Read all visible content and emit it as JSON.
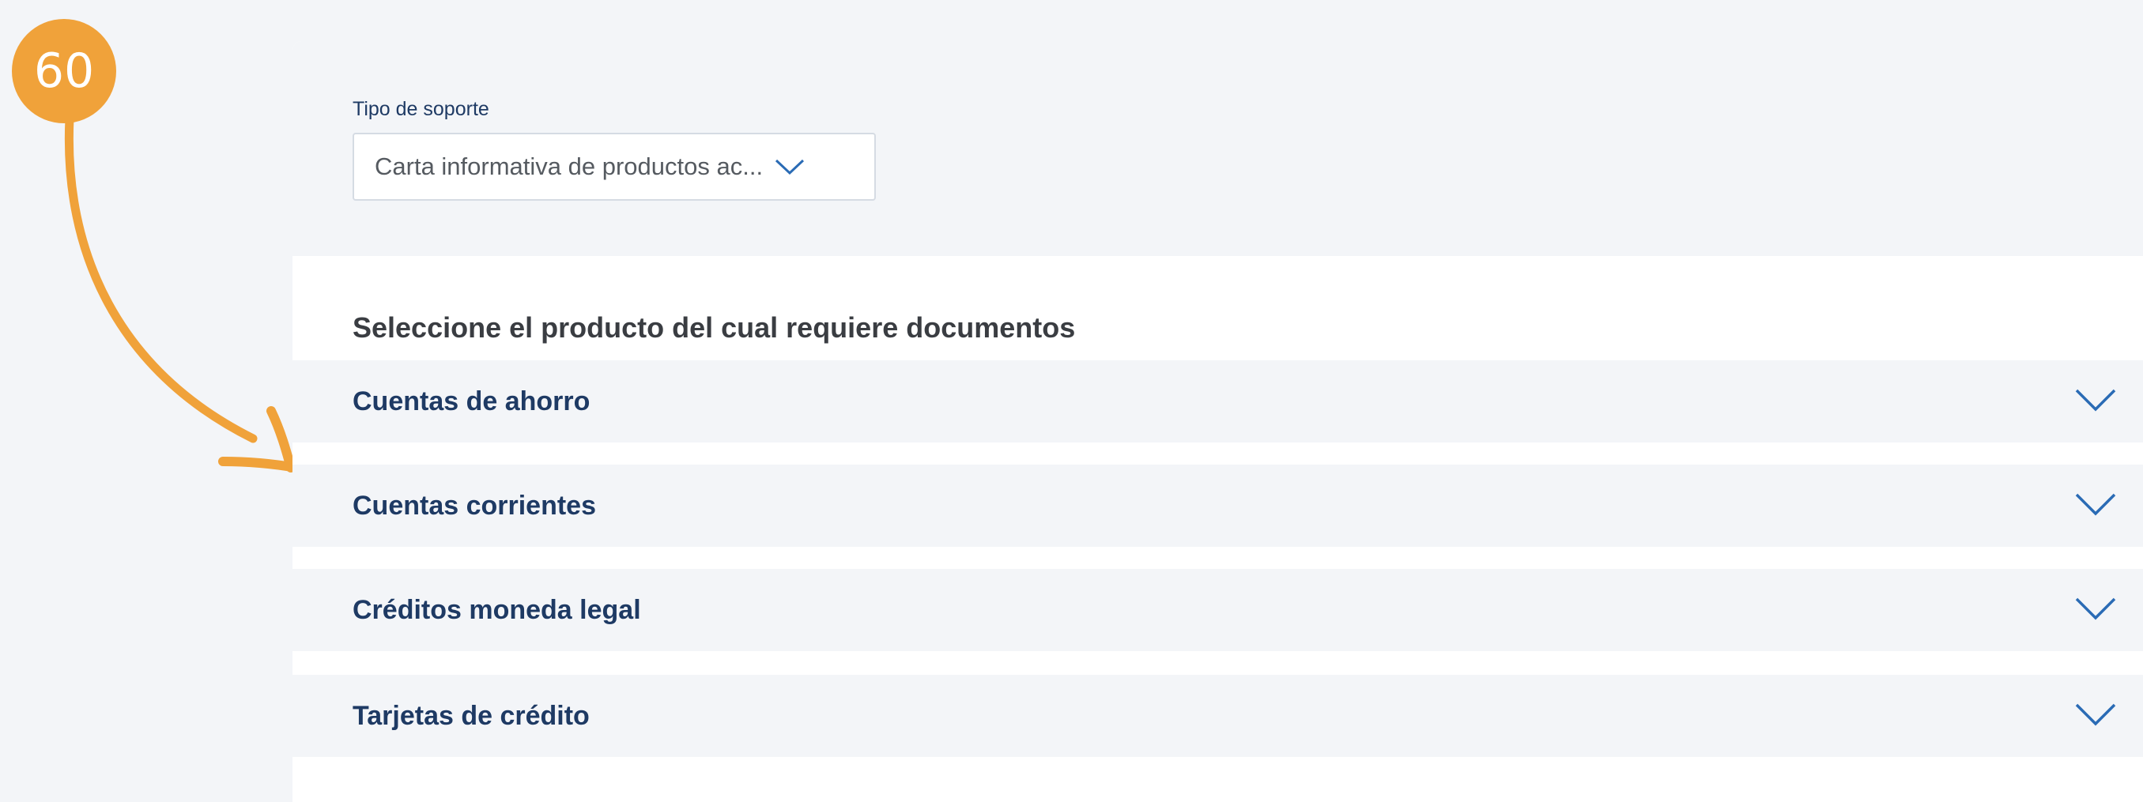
{
  "annotation": {
    "step_number": "60",
    "color": "#f0a23a"
  },
  "form": {
    "support_type_label": "Tipo de soporte",
    "support_type_value": "Carta informativa de productos ac...",
    "section_title": "Seleccione el producto del cual requiere documentos"
  },
  "products": [
    {
      "label": "Cuentas de ahorro",
      "icon": "chevron-down-icon"
    },
    {
      "label": "Cuentas corrientes",
      "icon": "chevron-down-icon"
    },
    {
      "label": "Créditos moneda legal",
      "icon": "chevron-down-icon"
    },
    {
      "label": "Tarjetas de crédito",
      "icon": "chevron-down-icon"
    }
  ],
  "colors": {
    "page_bg": "#f3f5f8",
    "card_bg": "#ffffff",
    "primary_text": "#1e3a64",
    "chevron": "#2a6bb5"
  }
}
